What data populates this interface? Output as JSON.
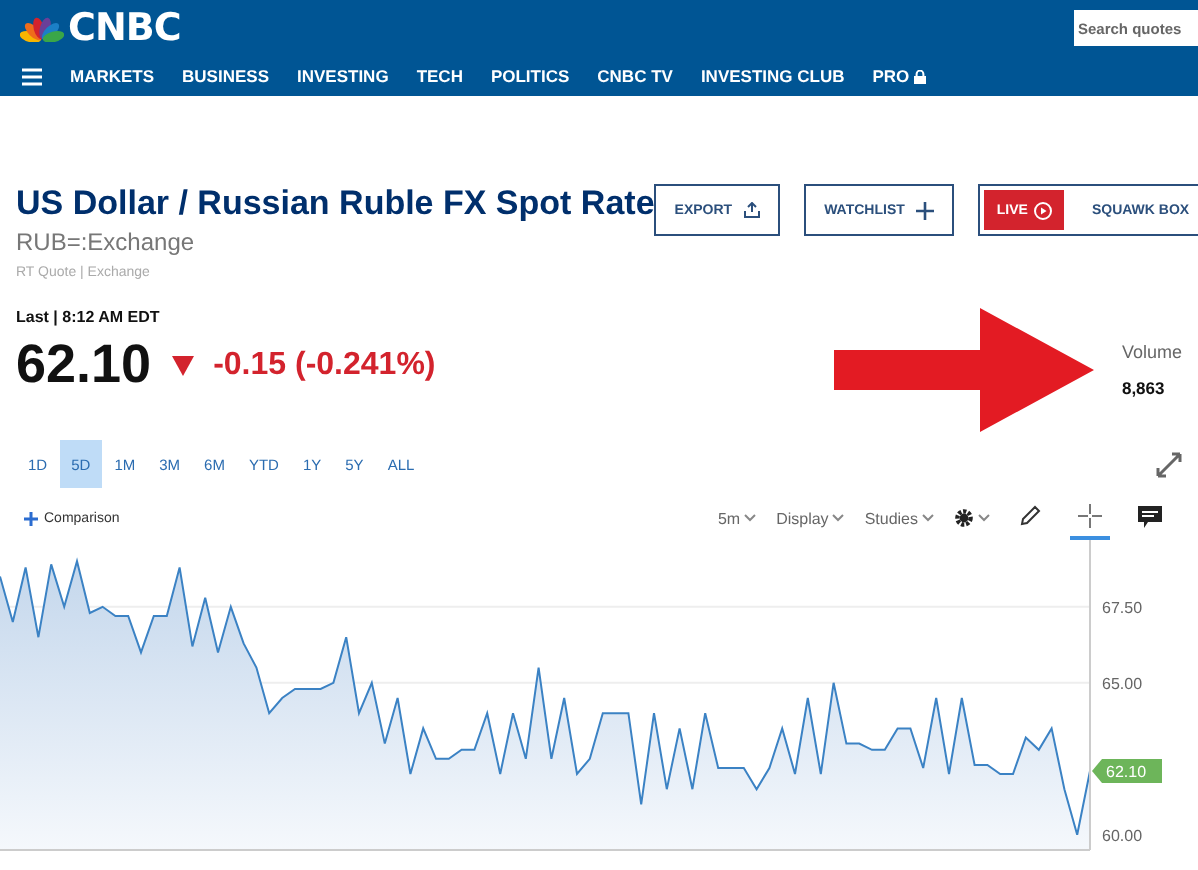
{
  "header": {
    "logo": "CNBC",
    "search": {
      "placeholder": "Search quotes"
    },
    "nav": [
      {
        "label": "MARKETS"
      },
      {
        "label": "BUSINESS"
      },
      {
        "label": "INVESTING"
      },
      {
        "label": "TECH"
      },
      {
        "label": "POLITICS"
      },
      {
        "label": "CNBC TV"
      },
      {
        "label": "INVESTING CLUB"
      },
      {
        "label": "PRO",
        "locked": true
      }
    ]
  },
  "quote": {
    "title": "US Dollar / Russian Ruble FX Spot Rate",
    "symbol": "RUB=:Exchange",
    "source": "RT Quote | Exchange",
    "last_label": "Last | 8:12 AM EDT",
    "price": "62.10",
    "change": "-0.15 (-0.241%)",
    "down": true,
    "volume_label": "Volume",
    "volume": "8,863"
  },
  "actions": [
    {
      "kind": "export",
      "label": "EXPORT"
    },
    {
      "kind": "watchlist",
      "label": "WATCHLIST"
    },
    {
      "kind": "live",
      "badge": "LIVE",
      "label": "SQUAWK BOX"
    }
  ],
  "ranges": [
    {
      "label": "1D",
      "selected": false
    },
    {
      "label": "5D",
      "selected": true
    },
    {
      "label": "1M",
      "selected": false
    },
    {
      "label": "3M",
      "selected": false
    },
    {
      "label": "6M",
      "selected": false
    },
    {
      "label": "YTD",
      "selected": false
    },
    {
      "label": "1Y",
      "selected": false
    },
    {
      "label": "5Y",
      "selected": false
    },
    {
      "label": "ALL",
      "selected": false
    }
  ],
  "toolbar": {
    "comparison": "Comparison",
    "menus": [
      {
        "label": "5m"
      },
      {
        "label": "Display"
      },
      {
        "label": "Studies"
      }
    ],
    "tools": [
      {
        "kind": "pencil",
        "selected": false
      },
      {
        "kind": "crosshair",
        "selected": true
      },
      {
        "kind": "comment",
        "selected": false
      }
    ]
  },
  "chart": {
    "price_tag": "62.10",
    "chart_data": {
      "type": "area",
      "ylim": [
        59.5,
        69.7
      ],
      "yticks": [
        {
          "value": 60,
          "label": "60.00"
        },
        {
          "value": 65,
          "label": "65.00"
        },
        {
          "value": 67.5,
          "label": "67.50"
        }
      ],
      "series": [
        {
          "color": "#3b82c4",
          "values": [
            68.5,
            67,
            68.8,
            66.5,
            68.9,
            67.5,
            69,
            67.3,
            67.5,
            67.2,
            67.2,
            66,
            67.2,
            67.2,
            68.8,
            66.2,
            67.8,
            66,
            67.5,
            66.3,
            65.5,
            64,
            64.5,
            64.8,
            64.8,
            64.8,
            65,
            66.5,
            64,
            65,
            63,
            64.5,
            62,
            63.5,
            62.5,
            62.5,
            62.8,
            62.8,
            64,
            62,
            64,
            62.5,
            65.5,
            62.5,
            64.5,
            62,
            62.5,
            64,
            64,
            64,
            61,
            64,
            61.5,
            63.5,
            61.5,
            64,
            62.2,
            62.2,
            62.2,
            61.5,
            62.2,
            63.5,
            62,
            64.5,
            62,
            65,
            63,
            63,
            62.8,
            62.8,
            63.5,
            63.5,
            62.2,
            64.5,
            62,
            64.5,
            62.3,
            62.3,
            62,
            62,
            63.2,
            62.8,
            63.5,
            61.5,
            60,
            62.1
          ]
        }
      ]
    }
  }
}
